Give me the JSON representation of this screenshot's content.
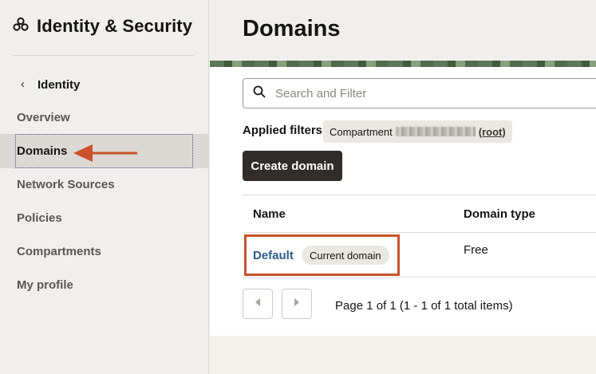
{
  "app": {
    "title": "Identity & Security"
  },
  "sidebar": {
    "back_label": "Identity",
    "items": [
      {
        "label": "Overview"
      },
      {
        "label": "Domains",
        "active": true
      },
      {
        "label": "Network Sources"
      },
      {
        "label": "Policies"
      },
      {
        "label": "Compartments"
      },
      {
        "label": "My profile"
      }
    ]
  },
  "main": {
    "title": "Domains",
    "search": {
      "placeholder": "Search and Filter"
    },
    "filters": {
      "label": "Applied filters",
      "chip_prefix": "Compartment",
      "chip_suffix": "(root)"
    },
    "create_button": "Create domain",
    "table": {
      "headers": [
        "Name",
        "Domain type"
      ],
      "rows": [
        {
          "name": "Default",
          "badge": "Current domain",
          "type": "Free"
        }
      ]
    },
    "pager": {
      "text": "Page 1 of 1 (1 - 1 of 1 total items)"
    }
  },
  "colors": {
    "accent_annotation": "#c9522a",
    "link": "#2f5b8a",
    "button_bg": "#312d2a"
  }
}
